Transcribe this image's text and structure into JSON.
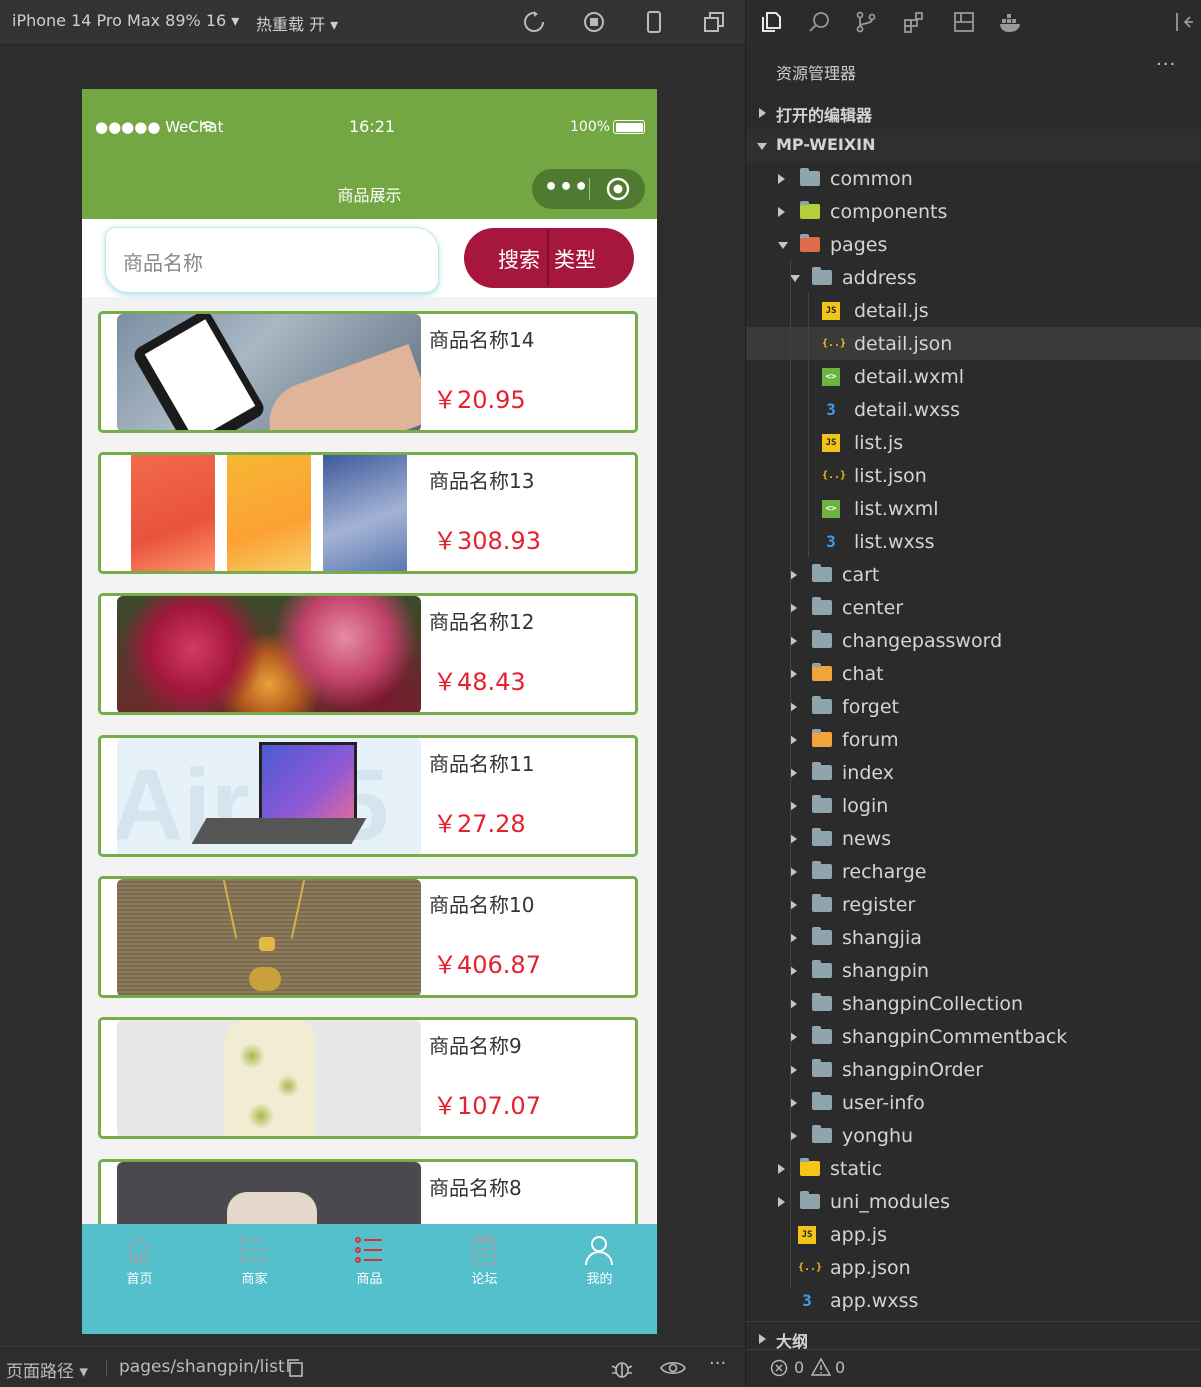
{
  "toolbar": {
    "device": "iPhone 14 Pro Max 89% 16",
    "hotreload": "热重载 开"
  },
  "status": {
    "carrier": "●●●●● WeChat",
    "time": "16:21",
    "battery": "100%"
  },
  "nav": {
    "title": "商品展示"
  },
  "search": {
    "placeholder": "商品名称",
    "search_label": "搜索",
    "type_label": "类型"
  },
  "products": [
    {
      "name": "商品名称14",
      "price": "￥20.95"
    },
    {
      "name": "商品名称13",
      "price": "￥308.93"
    },
    {
      "name": "商品名称12",
      "price": "￥48.43"
    },
    {
      "name": "商品名称11",
      "price": "￥27.28"
    },
    {
      "name": "商品名称10",
      "price": "￥406.87"
    },
    {
      "name": "商品名称9",
      "price": "￥107.07"
    },
    {
      "name": "商品名称8",
      "price": ""
    }
  ],
  "tabs": [
    {
      "label": "首页",
      "icon": "home-icon"
    },
    {
      "label": "商家",
      "icon": "list-icon"
    },
    {
      "label": "商品",
      "icon": "list-icon",
      "active": true
    },
    {
      "label": "论坛",
      "icon": "clipboard-icon"
    },
    {
      "label": "我的",
      "icon": "user-icon"
    }
  ],
  "bottombar": {
    "path_label": "页面路径",
    "path": "pages/shangpin/list"
  },
  "explorer": {
    "title": "资源管理器",
    "open_editors": "打开的编辑器",
    "project": "MP-WEIXIN",
    "outline": "大纲",
    "problems_errors": "0",
    "problems_warnings": "0",
    "tree": [
      {
        "name": "common",
        "type": "folder"
      },
      {
        "name": "components",
        "type": "folder"
      },
      {
        "name": "pages",
        "type": "folder"
      },
      {
        "name": "address",
        "type": "folder"
      },
      {
        "name": "detail.js",
        "type": "js"
      },
      {
        "name": "detail.json",
        "type": "json"
      },
      {
        "name": "detail.wxml",
        "type": "wxml"
      },
      {
        "name": "detail.wxss",
        "type": "wxss"
      },
      {
        "name": "list.js",
        "type": "js"
      },
      {
        "name": "list.json",
        "type": "json"
      },
      {
        "name": "list.wxml",
        "type": "wxml"
      },
      {
        "name": "list.wxss",
        "type": "wxss"
      },
      {
        "name": "cart",
        "type": "folder"
      },
      {
        "name": "center",
        "type": "folder"
      },
      {
        "name": "changepassword",
        "type": "folder"
      },
      {
        "name": "chat",
        "type": "folder"
      },
      {
        "name": "forget",
        "type": "folder"
      },
      {
        "name": "forum",
        "type": "folder"
      },
      {
        "name": "index",
        "type": "folder"
      },
      {
        "name": "login",
        "type": "folder"
      },
      {
        "name": "news",
        "type": "folder"
      },
      {
        "name": "recharge",
        "type": "folder"
      },
      {
        "name": "register",
        "type": "folder"
      },
      {
        "name": "shangjia",
        "type": "folder"
      },
      {
        "name": "shangpin",
        "type": "folder"
      },
      {
        "name": "shangpinCollection",
        "type": "folder"
      },
      {
        "name": "shangpinCommentback",
        "type": "folder"
      },
      {
        "name": "shangpinOrder",
        "type": "folder"
      },
      {
        "name": "user-info",
        "type": "folder"
      },
      {
        "name": "yonghu",
        "type": "folder"
      },
      {
        "name": "static",
        "type": "folder"
      },
      {
        "name": "uni_modules",
        "type": "folder"
      },
      {
        "name": "app.js",
        "type": "js"
      },
      {
        "name": "app.json",
        "type": "json"
      },
      {
        "name": "app.wxss",
        "type": "wxss"
      }
    ]
  },
  "colors": {
    "green": "#73a743",
    "search_btn": "#a6163d",
    "tabbar": "#54c0cc",
    "price": "#e5212d"
  }
}
